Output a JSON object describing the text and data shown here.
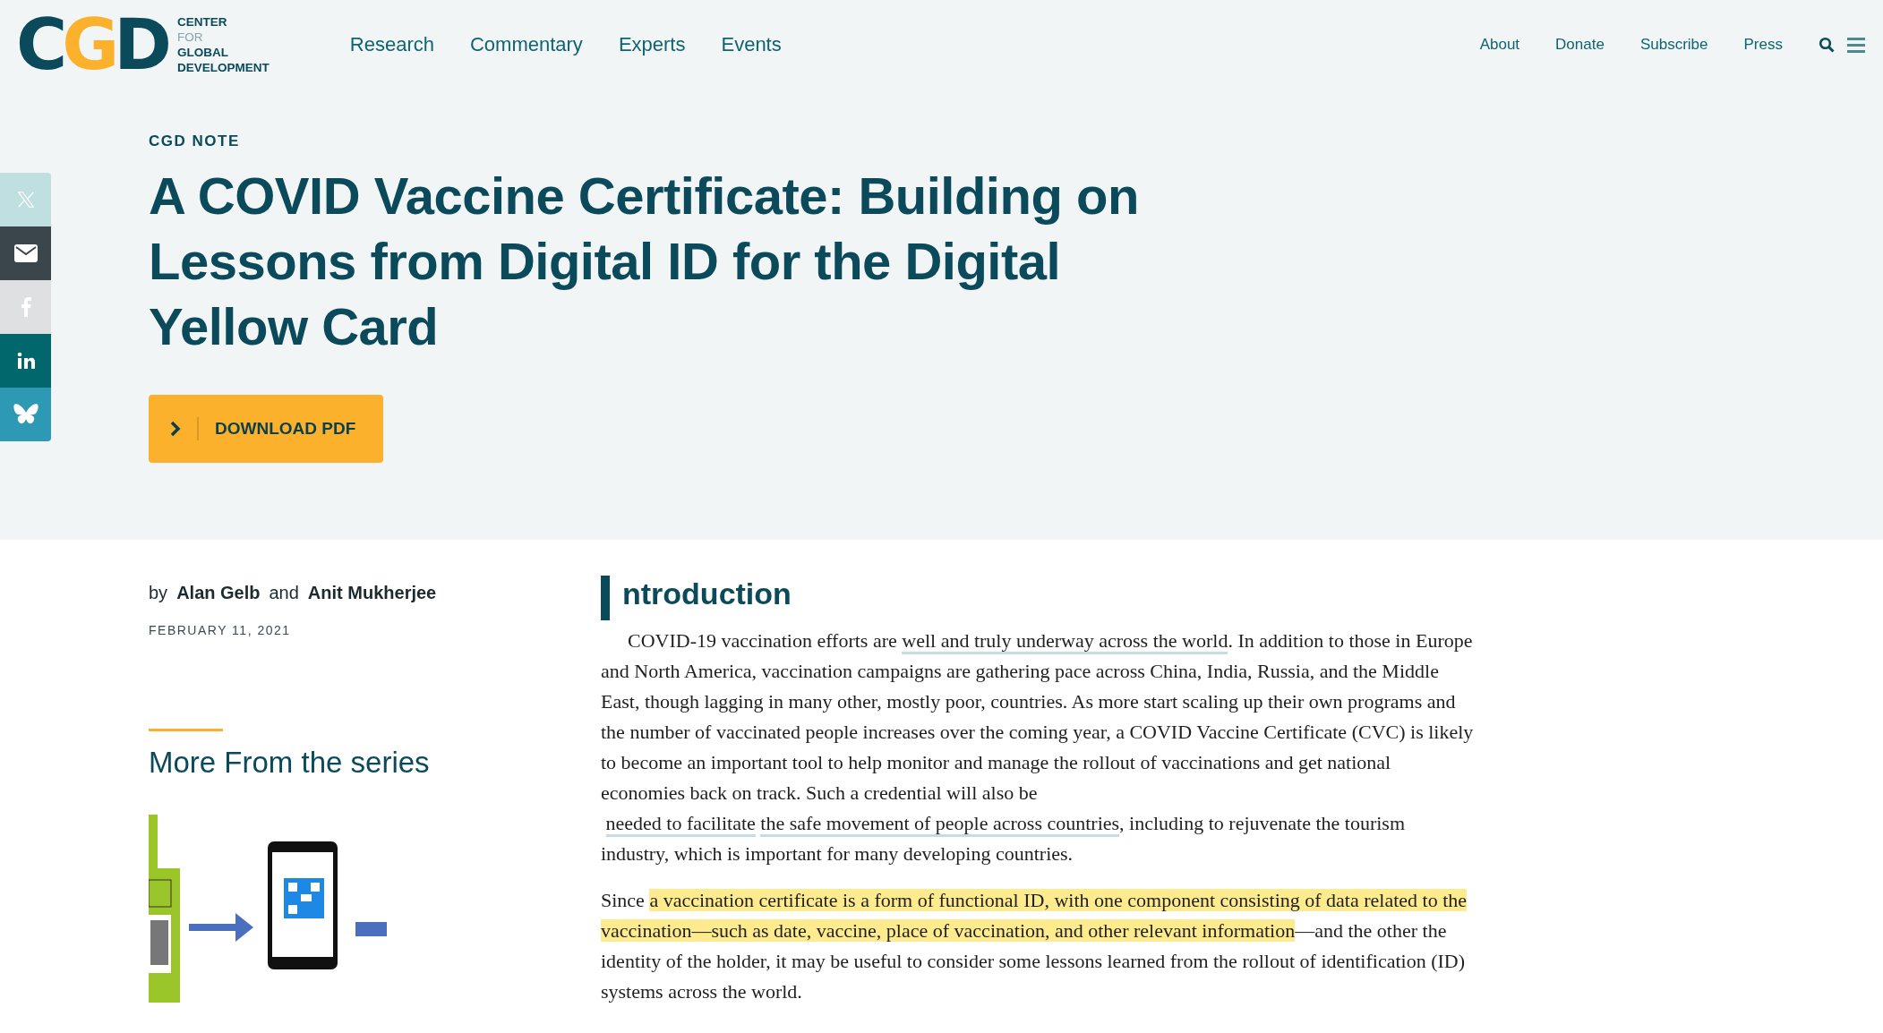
{
  "header": {
    "logo_mark": "CGD",
    "logo_lines": [
      {
        "text": "CENTER",
        "muted": false
      },
      {
        "text": "FOR",
        "muted": true
      },
      {
        "text": "GLOBAL",
        "muted": false
      },
      {
        "text": "DEVELOPMENT",
        "muted": false
      }
    ],
    "main_nav": [
      "Research",
      "Commentary",
      "Experts",
      "Events"
    ],
    "utility_nav": [
      "About",
      "Donate",
      "Subscribe",
      "Press"
    ]
  },
  "share_buttons": [
    {
      "kind": "x",
      "color": "#c0dfe1"
    },
    {
      "kind": "email",
      "color": "#3a464c"
    },
    {
      "kind": "facebook",
      "color": "#dfe0e2"
    },
    {
      "kind": "linkedin",
      "color": "#02676c"
    },
    {
      "kind": "bluesky",
      "color": "#2e99b5"
    }
  ],
  "hero": {
    "label": "CGD NOTE",
    "title": "A COVID Vaccine Certificate: Building on Lessons from Digital ID for the Digital Yellow Card",
    "download_button": "DOWNLOAD PDF"
  },
  "byline": {
    "prefix": "by",
    "joiner": "and",
    "authors": [
      "Alan Gelb",
      "Anit Mukherjee"
    ],
    "date": "FEBRUARY 11, 2021"
  },
  "series": {
    "heading": "More From the series"
  },
  "article": {
    "heading": "ntroduction",
    "paragraphs": [
      [
        {
          "kind": "text",
          "text": "COVID-19 vaccination efforts are "
        },
        {
          "kind": "link",
          "text": "well and truly underway across the world"
        },
        {
          "kind": "text",
          "text": ". In addition to those in Europe and North America, vaccination campaigns are gathering pace across China, India, Russia, and the Middle East, though lagging in many other, mostly poor, countries. As more start scaling up their own programs and the number of vaccinated people increases over the coming year, a COVID Vaccine Certificate (CVC) is likely to become an important tool to help monitor and manage the rollout of vaccinations and get national economies back on track. Such a credential will also be "
        },
        {
          "kind": "link",
          "text": "needed to facilitate"
        },
        {
          "kind": "link",
          "text": "the safe movement of people across countries"
        },
        {
          "kind": "text",
          "text": ", including to rejuvenate the tourism industry, which is important for many developing countries."
        }
      ],
      [
        {
          "kind": "text",
          "text": "Since "
        },
        {
          "kind": "highlight",
          "text": "a vaccination certificate is a form of functional ID, with one component consisting of data related to the vaccination—such as date, vaccine, place of vaccination, and other relevant information"
        },
        {
          "kind": "text",
          "text": "—and the other the identity of the holder, it may be useful to consider some lessons learned from the rollout of identification (ID) systems across the world."
        }
      ]
    ]
  }
}
